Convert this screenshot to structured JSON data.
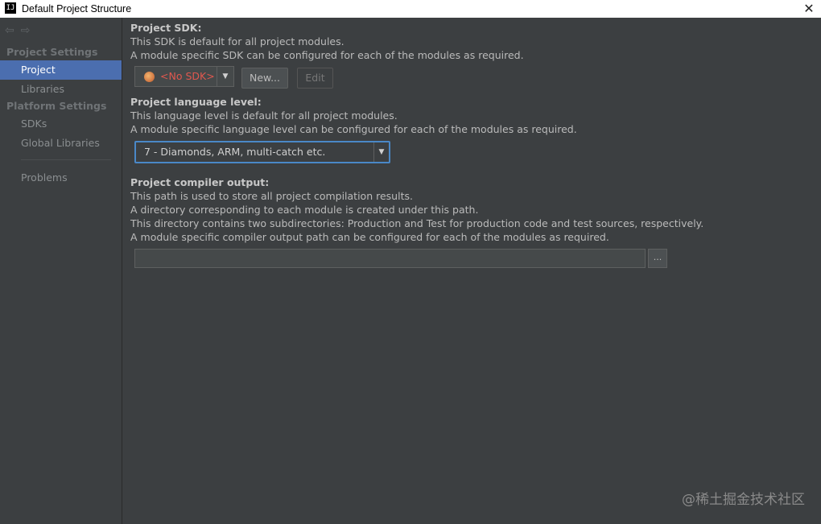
{
  "window": {
    "title": "Default Project Structure",
    "app_icon_text": "IJ",
    "close_glyph": "✕"
  },
  "nav": {
    "back_glyph": "⇦",
    "forward_glyph": "⇨"
  },
  "sidebar": {
    "project_settings_header": "Project Settings",
    "platform_settings_header": "Platform Settings",
    "items": [
      {
        "label": "Project",
        "selected": true
      },
      {
        "label": "Libraries"
      },
      {
        "label": "SDKs"
      },
      {
        "label": "Global Libraries"
      },
      {
        "label": "Problems"
      }
    ]
  },
  "sdk": {
    "heading": "Project SDK:",
    "line1": "This SDK is default for all project modules.",
    "line2": "A module specific SDK can be configured for each of the modules as required.",
    "selected": "<No SDK>",
    "new_button": "New...",
    "edit_button": "Edit"
  },
  "language": {
    "heading": "Project language level:",
    "line1": "This language level is default for all project modules.",
    "line2": "A module specific language level can be configured for each of the modules as required.",
    "selected": "7 - Diamonds, ARM, multi-catch etc."
  },
  "compiler": {
    "heading": "Project compiler output:",
    "line1": "This path is used to store all project compilation results.",
    "line2": "A directory corresponding to each module is created under this path.",
    "line3": "This directory contains two subdirectories: Production and Test for production code and test sources, respectively.",
    "line4": "A module specific compiler output path can be configured for each of the modules as required.",
    "path_value": "",
    "browse_label": "..."
  },
  "watermark": "@稀土掘金技术社区",
  "colors": {
    "background": "#3c3f41",
    "selection": "#4b6eaf",
    "focus_border": "#4a88c7",
    "no_sdk_text": "#e0584f"
  }
}
